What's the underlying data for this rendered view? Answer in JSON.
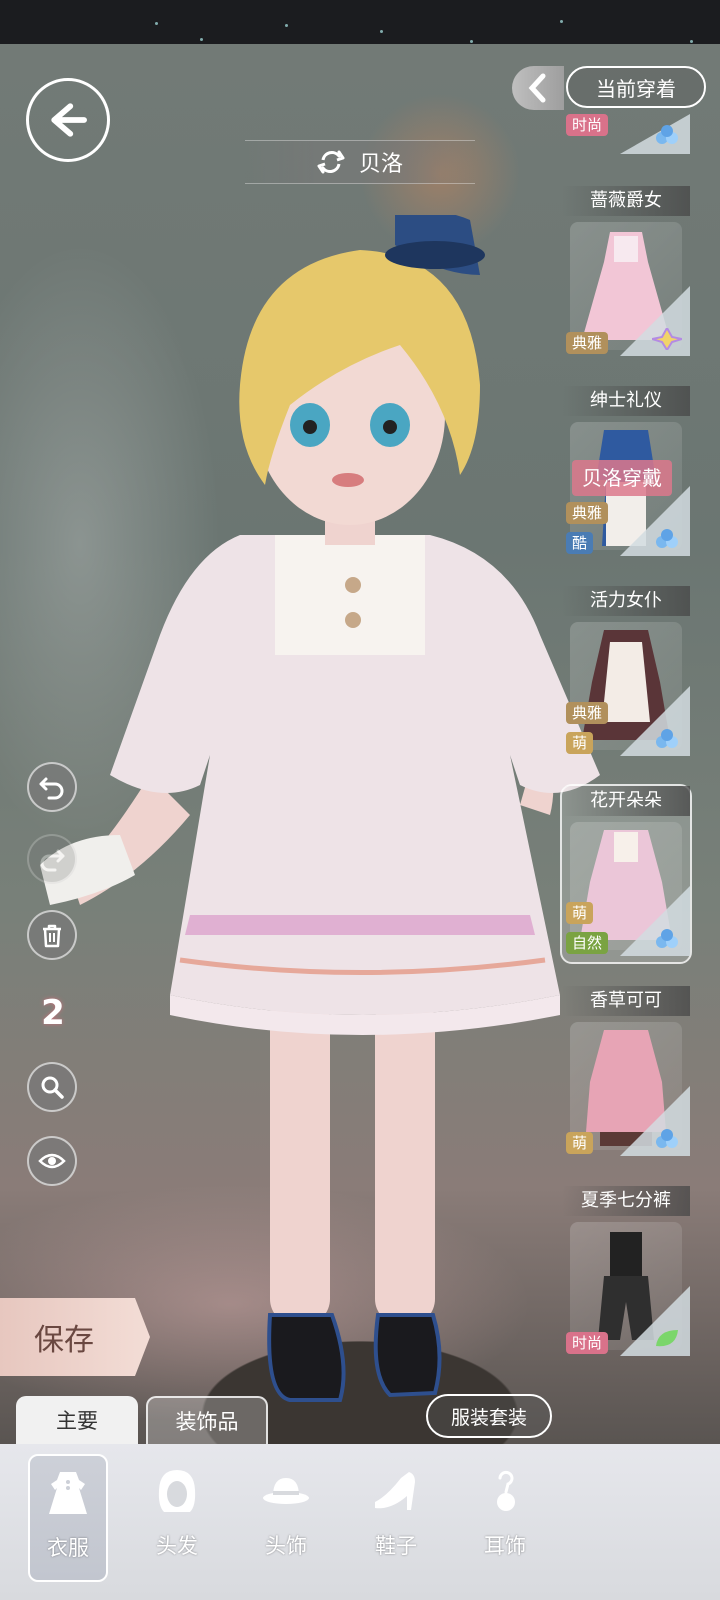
{
  "header": {
    "character_name": "贝洛",
    "current_wearing_button": "当前穿着"
  },
  "outfits": [
    {
      "name": "",
      "tags": [
        "时尚"
      ]
    },
    {
      "name": "蔷薇爵女",
      "tags": [
        "典雅"
      ]
    },
    {
      "name": "绅士礼仪",
      "tags": [
        "典雅",
        "酷"
      ],
      "overlay": "贝洛穿戴"
    },
    {
      "name": "活力女仆",
      "tags": [
        "典雅",
        "萌"
      ]
    },
    {
      "name": "花开朵朵",
      "tags": [
        "萌",
        "自然"
      ],
      "selected": true
    },
    {
      "name": "香草可可",
      "tags": [
        "萌"
      ]
    },
    {
      "name": "夏季七分裤",
      "tags": [
        "时尚"
      ]
    }
  ],
  "tools": {
    "slot_count": "2"
  },
  "actions": {
    "save": "保存",
    "suit": "服装套装"
  },
  "tabs": {
    "main": "主要",
    "accessories": "装饰品"
  },
  "bottom_nav": [
    {
      "label": "衣服",
      "icon": "dress-icon",
      "active": true
    },
    {
      "label": "头发",
      "icon": "hair-icon"
    },
    {
      "label": "头饰",
      "icon": "hat-icon"
    },
    {
      "label": "鞋子",
      "icon": "high-heel-icon"
    },
    {
      "label": "耳饰",
      "icon": "earring-icon"
    }
  ],
  "colors": {
    "tag_fashion": "#d9728a",
    "tag_elegant": "#b1905c",
    "tag_cool": "#4a7cb4",
    "tag_cute": "#c9a45b",
    "tag_nature": "#7aa342"
  }
}
